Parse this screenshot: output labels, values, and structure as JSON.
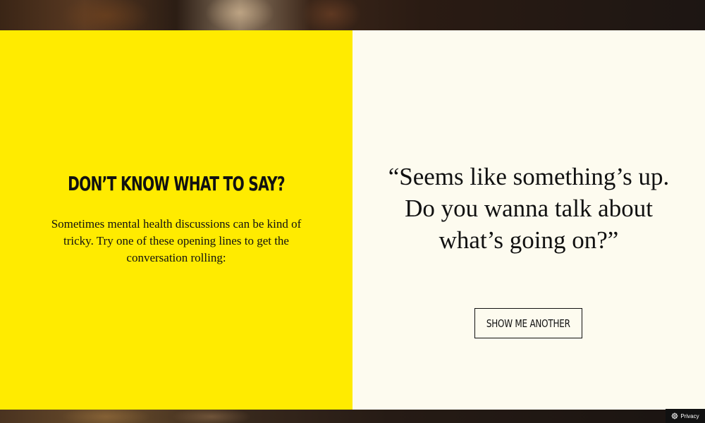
{
  "left": {
    "heading": "DON’T KNOW WHAT TO SAY?",
    "intro": "Sometimes mental health discussions can be kind of tricky. Try one of these opening lines to get the conversation rolling:"
  },
  "right": {
    "quote": "“Seems like something’s up. Do you wanna talk about what’s going on?”",
    "button_label": "SHOW ME ANOTHER"
  },
  "privacy": {
    "icon": "gear-icon",
    "label": "Privacy"
  },
  "colors": {
    "left_panel": "#ffeb00",
    "right_panel": "#fdfbef",
    "text": "#111111"
  }
}
